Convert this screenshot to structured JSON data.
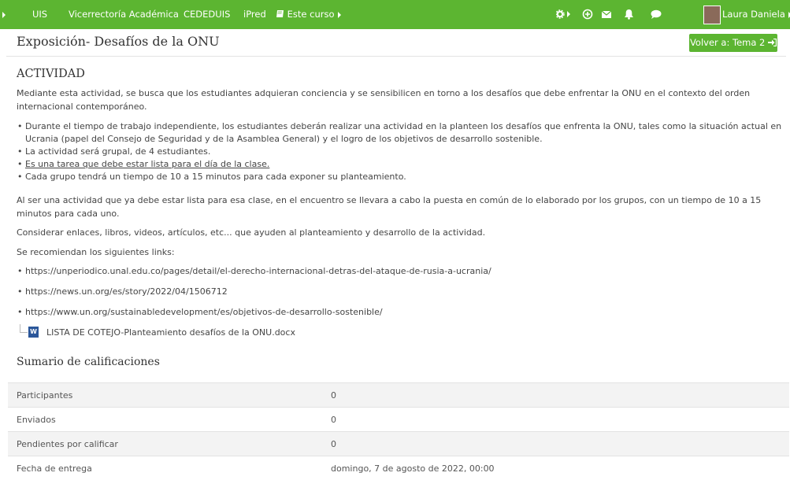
{
  "navbar": {
    "items": [
      "UIS",
      "Vicerrectoría Académica",
      "CEDEDUIS",
      "iPred"
    ],
    "course_menu": "Este curso",
    "user_name": "Laura Daniela",
    "icons": [
      "gear-icon",
      "add-circle-icon",
      "envelope-icon",
      "bell-icon",
      "chat-bubble-icon"
    ],
    "bg_color": "#5cb531"
  },
  "page": {
    "title": "Exposición- Desafíos de la ONU",
    "back_button": "Volver a: Tema 2"
  },
  "activity": {
    "heading": "ACTIVIDAD",
    "intro": "Mediante esta actividad, se busca que los estudiantes adquieran conciencia y se sensibilicen en torno a los desafíos que debe enfrentar la  ONU en el contexto del orden internacional contemporáneo.",
    "bullets": [
      "Durante el tiempo de trabajo independiente, los estudiantes deberán realizar una actividad en la planteen los desafíos que enfrenta la ONU, tales como la situación actual en Ucrania (papel del Consejo de Seguridad y de la Asamblea General) y el logro de los objetivos de desarrollo sostenible.",
      "La actividad será grupal, de 4 estudiantes.",
      "Es una tarea que debe estar lista para el día de la clase.",
      "Cada grupo tendrá un tiempo de 10 a 15 minutos para cada exponer su planteamiento."
    ],
    "para2": "Al ser una actividad que ya debe estar lista para esa clase, en el encuentro se llevara a cabo la puesta en común de lo elaborado por los grupos, con un tiempo de 10 a 15 minutos para cada uno.",
    "para3": "Considerar enlaces, libros, videos, artículos, etc... que ayuden al planteamiento y desarrollo de la actividad.",
    "para4": "Se recomiendan los siguientes links:",
    "links": [
      "https://unperiodico.unal.edu.co/pages/detail/el-derecho-internacional-detras-del-ataque-de-rusia-a-ucrania/",
      "https://news.un.org/es/story/2022/04/1506712",
      "https://www.un.org/sustainabledevelopment/es/objetivos-de-desarrollo-sostenible/"
    ],
    "file_name": "LISTA DE COTEJO-Planteamiento desafíos de la ONU.docx",
    "file_icon": "word-doc-icon"
  },
  "summary": {
    "heading": "Sumario de calificaciones",
    "rows": [
      {
        "label": "Participantes",
        "value": "0"
      },
      {
        "label": "Enviados",
        "value": "0"
      },
      {
        "label": "Pendientes por calificar",
        "value": "0"
      },
      {
        "label": "Fecha de entrega",
        "value": "domingo, 7 de agosto de 2022, 00:00"
      }
    ]
  }
}
